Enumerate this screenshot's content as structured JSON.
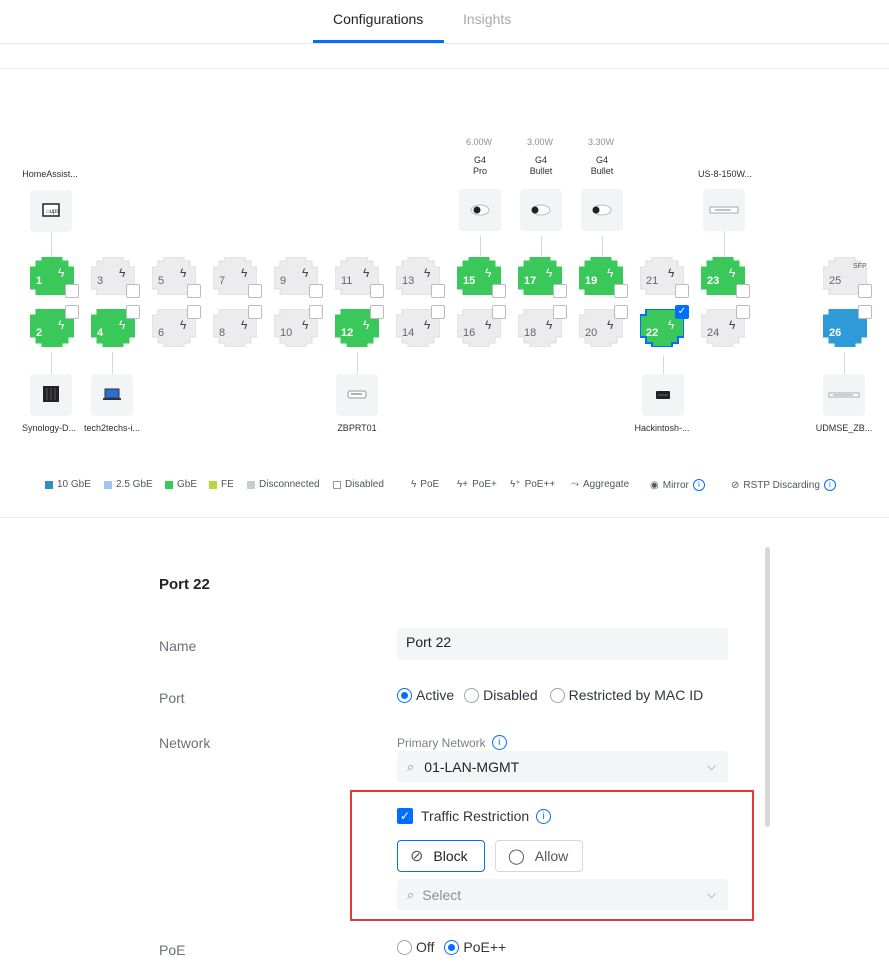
{
  "tabs": [
    {
      "label": "Configurations"
    },
    {
      "label": "Insights"
    }
  ],
  "powers": [
    "6.00W",
    "3.00W",
    "3.30W"
  ],
  "devices": {
    "g4pro": [
      "G4",
      "Pro"
    ],
    "g4bullet1": [
      "G4",
      "Bullet"
    ],
    "g4bullet2": [
      "G4",
      "Bullet"
    ],
    "homeassist": "HomeAssist...",
    "us8": "US-8-150W...",
    "synology": "Synology-D...",
    "tech2techs": "tech2techs-i...",
    "zbprt01": "ZBPRT01",
    "hackintosh": "Hackintosh-...",
    "udmse": "UDMSE_ZB..."
  },
  "ports": {
    "p1": "1",
    "p2": "2",
    "p3": "3",
    "p4": "4",
    "p5": "5",
    "p6": "6",
    "p7": "7",
    "p8": "8",
    "p9": "9",
    "p10": "10",
    "p11": "11",
    "p12": "12",
    "p13": "13",
    "p14": "14",
    "p15": "15",
    "p16": "16",
    "p17": "17",
    "p18": "18",
    "p19": "19",
    "p20": "20",
    "p21": "21",
    "p22": "22",
    "p23": "23",
    "p24": "24",
    "p25": "25",
    "p26": "26",
    "sfp": "SFP"
  },
  "legend": {
    "gbe10": "10 GbE",
    "gbe25": "2.5 GbE",
    "gbe": "GbE",
    "fe": "FE",
    "disconnected": "Disconnected",
    "disabled": "Disabled",
    "poe": "PoE",
    "poeplus": "PoE+",
    "poeplusplus": "PoE++",
    "aggregate": "Aggregate",
    "mirror": "Mirror",
    "rstp": "RSTP Discarding"
  },
  "colors": {
    "gbe": "#3bc85a",
    "ten_gbe": "#2f9bd6",
    "disconnected": "#ececee",
    "accent": "#006fff"
  },
  "form": {
    "title": "Port 22",
    "name_label": "Name",
    "name_value": "Port 22",
    "port_label": "Port",
    "port_options": {
      "active": "Active",
      "disabled": "Disabled",
      "restricted": "Restricted by MAC ID"
    },
    "network_label": "Network",
    "primary_network_label": "Primary Network",
    "primary_network_value": "01-LAN-MGMT",
    "traffic_restriction_label": "Traffic Restriction",
    "block_label": "Block",
    "allow_label": "Allow",
    "select_placeholder": "Select",
    "poe_label": "PoE",
    "poe_options": {
      "off": "Off",
      "poeplusplus": "PoE++"
    }
  }
}
